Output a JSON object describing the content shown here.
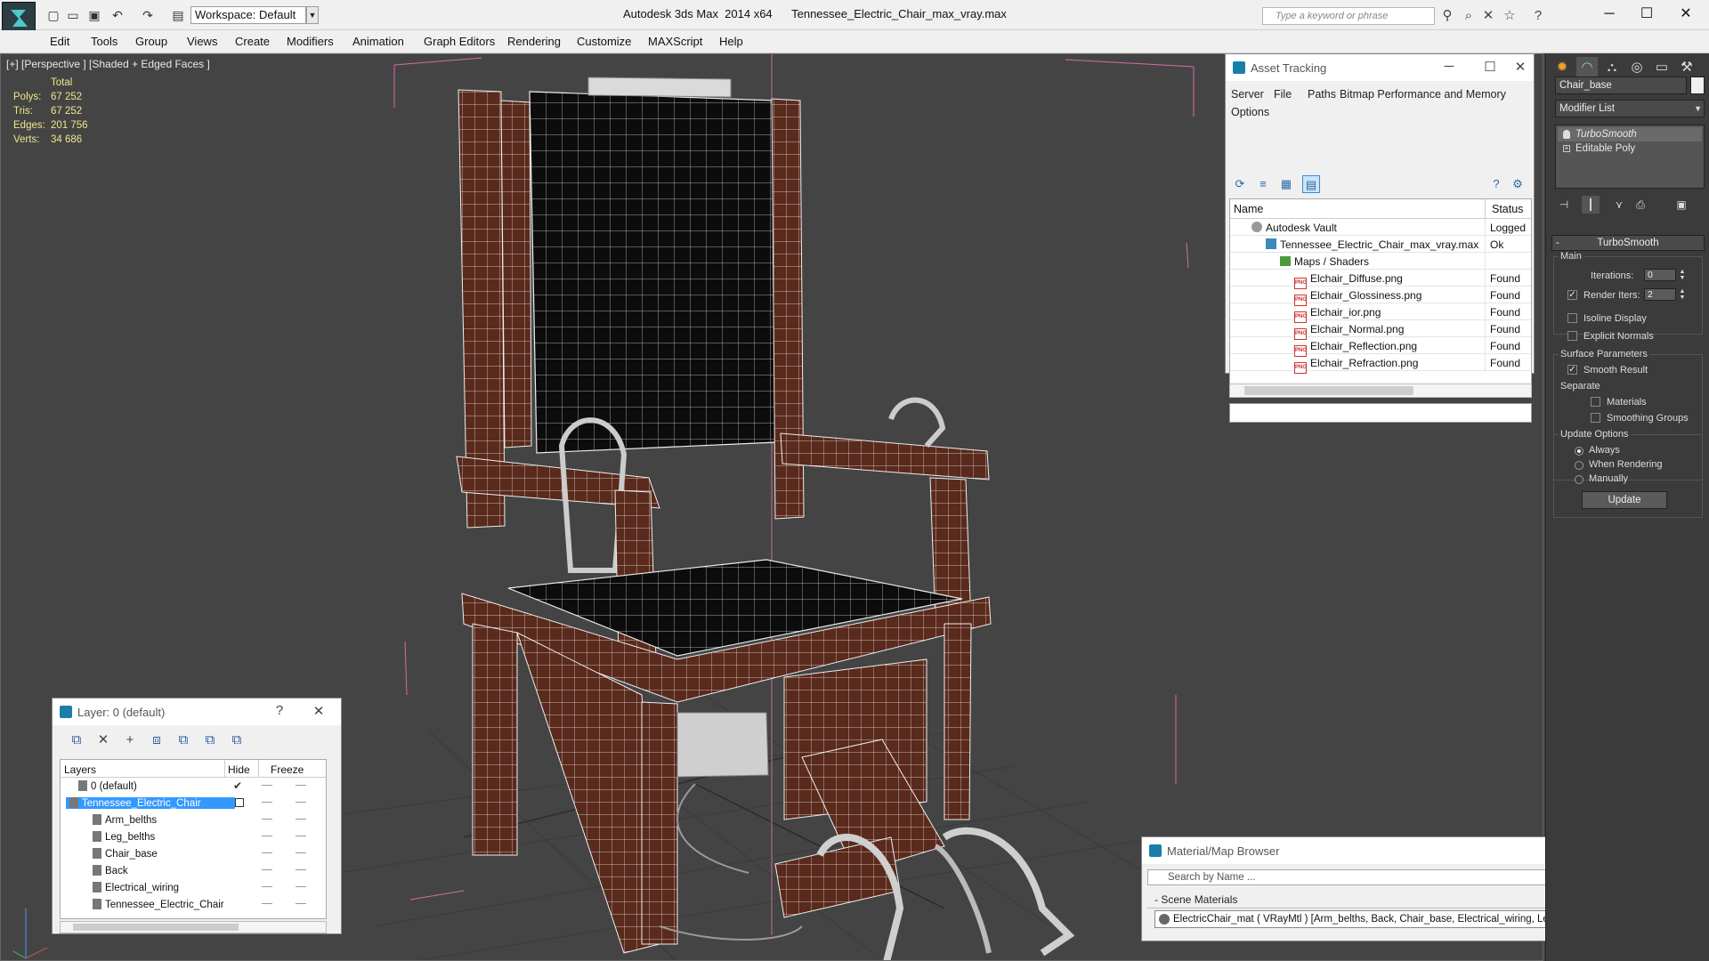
{
  "titlebar": {
    "workspace": "Workspace: Default",
    "app_title": "Autodesk 3ds Max  2014 x64",
    "file_title": "Tennessee_Electric_Chair_max_vray.max",
    "search_placeholder": "Type a keyword or phrase"
  },
  "menu": [
    "Edit",
    "Tools",
    "Group",
    "Views",
    "Create",
    "Modifiers",
    "Animation",
    "Graph Editors",
    "Rendering",
    "Customize",
    "MAXScript",
    "Help"
  ],
  "viewport": {
    "label": "[+] [Perspective ] [Shaded + Edged Faces ]",
    "stats": {
      "header": "Total",
      "rows": [
        {
          "label": "Polys:",
          "value": "67 252"
        },
        {
          "label": "Tris:",
          "value": "67 252"
        },
        {
          "label": "Edges:",
          "value": "201 756"
        },
        {
          "label": "Verts:",
          "value": "34 686"
        }
      ]
    }
  },
  "asset_tracking": {
    "title": "Asset Tracking",
    "menu": [
      "Server",
      "File",
      "Paths",
      "Bitmap Performance and Memory",
      "Options"
    ],
    "col_name": "Name",
    "col_status": "Status",
    "rows": [
      {
        "name": "Autodesk Vault",
        "status": "Logged Out",
        "icon": "vault-icon"
      },
      {
        "name": "Tennessee_Electric_Chair_max_vray.max",
        "status": "Ok",
        "icon": "max-file-icon"
      },
      {
        "name": "Maps / Shaders",
        "status": "",
        "icon": "folder-icon"
      },
      {
        "name": "Elchair_Diffuse.png",
        "status": "Found",
        "icon": "png-icon"
      },
      {
        "name": "Elchair_Glossiness.png",
        "status": "Found",
        "icon": "png-icon"
      },
      {
        "name": "Elchair_ior.png",
        "status": "Found",
        "icon": "png-icon"
      },
      {
        "name": "Elchair_Normal.png",
        "status": "Found",
        "icon": "png-icon"
      },
      {
        "name": "Elchair_Reflection.png",
        "status": "Found",
        "icon": "png-icon"
      },
      {
        "name": "Elchair_Refraction.png",
        "status": "Found",
        "icon": "png-icon"
      }
    ]
  },
  "layer_window": {
    "title": "Layer: 0 (default)",
    "help": "?",
    "col_layers": "Layers",
    "col_hide": "Hide",
    "col_freeze": "Freeze",
    "rows": [
      {
        "name": "0 (default)",
        "level": 1
      },
      {
        "name": "Tennessee_Electric_Chair",
        "level": 1,
        "selected": true
      },
      {
        "name": "Arm_belths",
        "level": 2
      },
      {
        "name": "Leg_belths",
        "level": 2
      },
      {
        "name": "Chair_base",
        "level": 2
      },
      {
        "name": "Back",
        "level": 2
      },
      {
        "name": "Electrical_wiring",
        "level": 2
      },
      {
        "name": "Tennessee_Electric_Chair",
        "level": 2
      }
    ]
  },
  "material_browser": {
    "title": "Material/Map Browser",
    "search_placeholder": "Search by Name ...",
    "group": "- Scene Materials",
    "material": "ElectricChair_mat  ( VRayMtl )  [Arm_belths, Back, Chair_base, Electrical_wiring, Leg_belths]",
    "swatch_color": "#cc0000"
  },
  "command_panel": {
    "object_name": "Chair_base",
    "modifier_list": "Modifier List",
    "stack": [
      "TurboSmooth",
      "Editable Poly"
    ],
    "rollout": "TurboSmooth",
    "main": "Main",
    "iterations_label": "Iterations:",
    "iterations_value": "0",
    "render_iters_label": "Render Iters:",
    "render_iters_value": "2",
    "isoline": "Isoline Display",
    "explicit_normals": "Explicit Normals",
    "surface_params": "Surface Parameters",
    "smooth_result": "Smooth Result",
    "separate": "Separate",
    "materials": "Materials",
    "smoothing_groups": "Smoothing Groups",
    "update_options": "Update Options",
    "always": "Always",
    "when_rendering": "When Rendering",
    "manually": "Manually",
    "update_button": "Update"
  }
}
